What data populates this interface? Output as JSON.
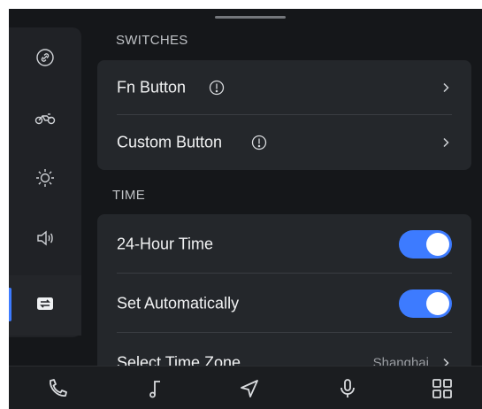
{
  "sidebar": {
    "items": [
      {
        "icon": "link-icon"
      },
      {
        "icon": "motorcycle-icon"
      },
      {
        "icon": "brightness-icon"
      },
      {
        "icon": "speaker-icon"
      },
      {
        "icon": "switch-settings-icon",
        "active": true
      }
    ],
    "accent_color": "#3d7bff"
  },
  "switches": {
    "title": "SWITCHES",
    "rows": [
      {
        "label": "Fn Button"
      },
      {
        "label": "Custom Button"
      }
    ]
  },
  "time": {
    "title": "TIME",
    "rows": [
      {
        "label": "24-Hour Time",
        "toggle_on": true
      },
      {
        "label": "Set Automatically",
        "toggle_on": true
      },
      {
        "label": "Select Time Zone",
        "value": "Shanghai"
      }
    ]
  },
  "bottom_nav": {
    "items": [
      "phone-icon",
      "music-note-icon",
      "navigation-icon",
      "microphone-icon",
      "apps-grid-icon"
    ]
  }
}
